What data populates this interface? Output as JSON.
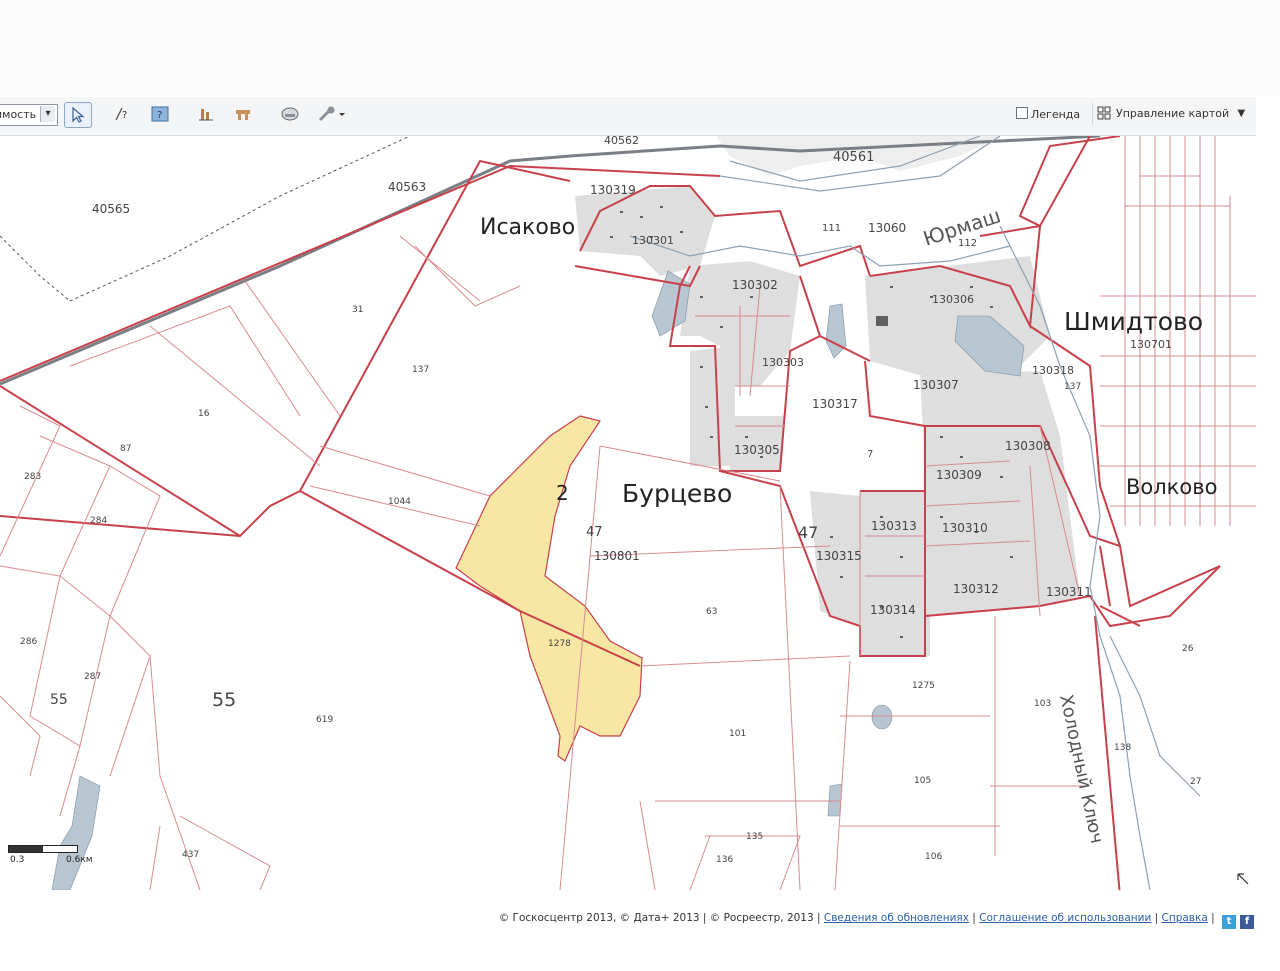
{
  "toolbar": {
    "layer_select": "имость",
    "legend_label": "Легенда",
    "map_control_label": "Управление картой"
  },
  "colors": {
    "parcel_line": "#c8404a",
    "parcel_thin": "#d98b90",
    "highlight_fill": "#f7e6a4",
    "built_area": "#d9d9dc",
    "water": "#b8c6d2",
    "railway": "#7a7f86"
  },
  "map": {
    "villages": [
      {
        "name": "Исаково"
      },
      {
        "name": "Бурцево"
      },
      {
        "name": "Шмидтово"
      },
      {
        "name": "Волково"
      }
    ],
    "rivers": [
      {
        "name": "Юрмаш"
      },
      {
        "name": "Холодный Ключ"
      }
    ],
    "parcels": [
      "40562",
      "40561",
      "40563",
      "40565",
      "130319",
      "130301",
      "111",
      "13060",
      "112",
      "130302",
      "130306",
      "130701",
      "130303",
      "130318",
      "137",
      "130307",
      "130317",
      "130305",
      "7",
      "130308",
      "130309",
      "1044",
      "2",
      "47",
      "130801",
      "1278",
      "63",
      "47",
      "130315",
      "130313",
      "130310",
      "130312",
      "130311",
      "130314",
      "283",
      "284",
      "286",
      "287",
      "55",
      "55",
      "619",
      "1275",
      "26",
      "101",
      "103",
      "138",
      "105",
      "27",
      "135",
      "136",
      "106",
      "437",
      "31",
      "137",
      "16",
      "87"
    ]
  },
  "scale": {
    "left": "0.3",
    "right": "0.6км"
  },
  "footer": {
    "copyright": "© Госкосцентр 2013, © Дата+ 2013 | © Росреестр, 2013 |",
    "link_updates": "Сведения об обновлениях",
    "link_terms": "Соглашение об использовании",
    "link_help": "Справка"
  }
}
